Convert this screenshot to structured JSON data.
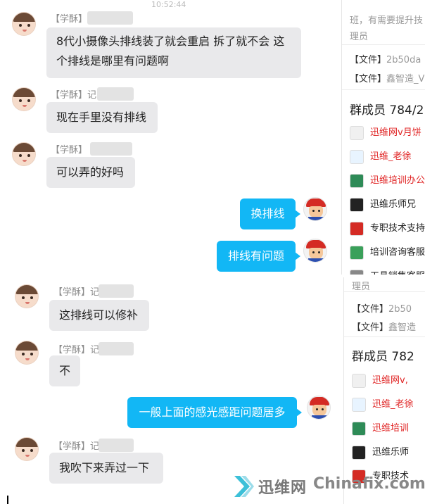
{
  "top_panel": {
    "status_time": "10:52:44",
    "messages": [
      {
        "sender": "【学酥】",
        "text_line1": "8代小摄像头排线装了就会重启  拆了就不会 这",
        "text_line2": "个排线是哪里有问题啊"
      },
      {
        "sender": "【学酥】记",
        "text": "现在手里没有排线"
      },
      {
        "sender": "【学酥】",
        "text": "可以弄的好吗"
      },
      {
        "text": "换排线"
      },
      {
        "text": "排线有问题"
      }
    ],
    "side": {
      "notice_line1": "班，有需要提升技",
      "notice_line2": "理员",
      "files": [
        {
          "label": "【文件】",
          "name": "2b50da"
        },
        {
          "label": "【文件】",
          "name": "鑫智造_V"
        }
      ],
      "members_title": "群成员 784/2",
      "members": [
        {
          "name": "迅维网v月饼",
          "color": "#e02424",
          "icon_color": "#f0f0f0"
        },
        {
          "name": "迅维_老徐",
          "color": "#e02424",
          "icon_color": "#e8f4ff"
        },
        {
          "name": "迅维培训办公",
          "color": "#e02424",
          "icon_color": "#2e8b57"
        },
        {
          "name": "迅维乐师兄",
          "color": "#222222",
          "icon_color": "#222222"
        },
        {
          "name": "专职技术支持",
          "color": "#222222",
          "icon_color": "#d42b24"
        },
        {
          "name": "培训咨询客服",
          "color": "#222222",
          "icon_color": "#3aa05a"
        },
        {
          "name": "工具销售客服",
          "color": "#222222",
          "icon_color": "#888888"
        }
      ]
    }
  },
  "bottom_panel": {
    "messages": [
      {
        "sender": "【学酥】记",
        "text": "这排线可以修补"
      },
      {
        "sender": "【学酥】记",
        "text": "不"
      },
      {
        "text": "一般上面的感光感距问题居多"
      },
      {
        "sender": "【学酥】记",
        "text": "我吹下来弄过一下"
      }
    ],
    "side": {
      "notice_line": "理员",
      "files": [
        {
          "label": "【文件】",
          "name": "2b50"
        },
        {
          "label": "【文件】",
          "name": "鑫智造"
        }
      ],
      "members_title": "群成员 782",
      "members": [
        {
          "name": "迅维网v,",
          "color": "#e02424",
          "icon_color": "#f0f0f0"
        },
        {
          "name": "迅维_老徐",
          "color": "#e02424",
          "icon_color": "#e8f4ff"
        },
        {
          "name": "迅维培训",
          "color": "#e02424",
          "icon_color": "#2e8b57"
        },
        {
          "name": "迅维乐师",
          "color": "#222222",
          "icon_color": "#222222"
        },
        {
          "name": "专职技术",
          "color": "#222222",
          "icon_color": "#d42b24"
        }
      ]
    }
  },
  "watermark": {
    "brand_cn": "迅维网",
    "brand_en": "Chinafix.com"
  },
  "colors": {
    "outgoing_bubble": "#12b7f5",
    "incoming_bubble": "#e9e9eb",
    "admin_name": "#e02424"
  }
}
